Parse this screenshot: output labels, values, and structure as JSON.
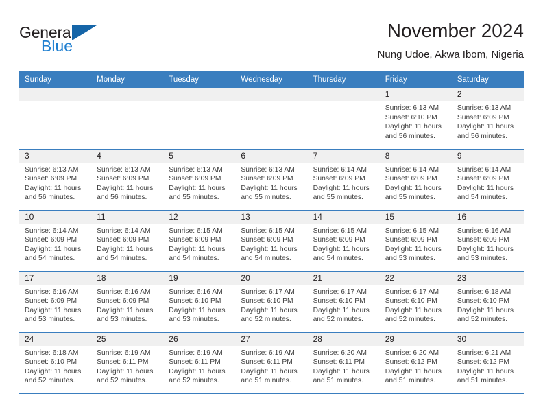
{
  "brand": {
    "line1": "General",
    "line2": "Blue",
    "logo_icon": "triangle-logo-icon",
    "accent_color": "#1f7fd0",
    "triangle_color": "#1565a8"
  },
  "header": {
    "title": "November 2024",
    "subtitle": "Nung Udoe, Akwa Ibom, Nigeria"
  },
  "calendar": {
    "header_bg": "#3a7ebf",
    "daynum_bg": "#f0f0f0",
    "weekday_labels": [
      "Sunday",
      "Monday",
      "Tuesday",
      "Wednesday",
      "Thursday",
      "Friday",
      "Saturday"
    ],
    "weeks": [
      [
        {
          "day": "",
          "sunrise": "",
          "sunset": "",
          "daylight_1": "",
          "daylight_2": ""
        },
        {
          "day": "",
          "sunrise": "",
          "sunset": "",
          "daylight_1": "",
          "daylight_2": ""
        },
        {
          "day": "",
          "sunrise": "",
          "sunset": "",
          "daylight_1": "",
          "daylight_2": ""
        },
        {
          "day": "",
          "sunrise": "",
          "sunset": "",
          "daylight_1": "",
          "daylight_2": ""
        },
        {
          "day": "",
          "sunrise": "",
          "sunset": "",
          "daylight_1": "",
          "daylight_2": ""
        },
        {
          "day": "1",
          "sunrise": "Sunrise: 6:13 AM",
          "sunset": "Sunset: 6:10 PM",
          "daylight_1": "Daylight: 11 hours",
          "daylight_2": "and 56 minutes."
        },
        {
          "day": "2",
          "sunrise": "Sunrise: 6:13 AM",
          "sunset": "Sunset: 6:09 PM",
          "daylight_1": "Daylight: 11 hours",
          "daylight_2": "and 56 minutes."
        }
      ],
      [
        {
          "day": "3",
          "sunrise": "Sunrise: 6:13 AM",
          "sunset": "Sunset: 6:09 PM",
          "daylight_1": "Daylight: 11 hours",
          "daylight_2": "and 56 minutes."
        },
        {
          "day": "4",
          "sunrise": "Sunrise: 6:13 AM",
          "sunset": "Sunset: 6:09 PM",
          "daylight_1": "Daylight: 11 hours",
          "daylight_2": "and 56 minutes."
        },
        {
          "day": "5",
          "sunrise": "Sunrise: 6:13 AM",
          "sunset": "Sunset: 6:09 PM",
          "daylight_1": "Daylight: 11 hours",
          "daylight_2": "and 55 minutes."
        },
        {
          "day": "6",
          "sunrise": "Sunrise: 6:13 AM",
          "sunset": "Sunset: 6:09 PM",
          "daylight_1": "Daylight: 11 hours",
          "daylight_2": "and 55 minutes."
        },
        {
          "day": "7",
          "sunrise": "Sunrise: 6:14 AM",
          "sunset": "Sunset: 6:09 PM",
          "daylight_1": "Daylight: 11 hours",
          "daylight_2": "and 55 minutes."
        },
        {
          "day": "8",
          "sunrise": "Sunrise: 6:14 AM",
          "sunset": "Sunset: 6:09 PM",
          "daylight_1": "Daylight: 11 hours",
          "daylight_2": "and 55 minutes."
        },
        {
          "day": "9",
          "sunrise": "Sunrise: 6:14 AM",
          "sunset": "Sunset: 6:09 PM",
          "daylight_1": "Daylight: 11 hours",
          "daylight_2": "and 54 minutes."
        }
      ],
      [
        {
          "day": "10",
          "sunrise": "Sunrise: 6:14 AM",
          "sunset": "Sunset: 6:09 PM",
          "daylight_1": "Daylight: 11 hours",
          "daylight_2": "and 54 minutes."
        },
        {
          "day": "11",
          "sunrise": "Sunrise: 6:14 AM",
          "sunset": "Sunset: 6:09 PM",
          "daylight_1": "Daylight: 11 hours",
          "daylight_2": "and 54 minutes."
        },
        {
          "day": "12",
          "sunrise": "Sunrise: 6:15 AM",
          "sunset": "Sunset: 6:09 PM",
          "daylight_1": "Daylight: 11 hours",
          "daylight_2": "and 54 minutes."
        },
        {
          "day": "13",
          "sunrise": "Sunrise: 6:15 AM",
          "sunset": "Sunset: 6:09 PM",
          "daylight_1": "Daylight: 11 hours",
          "daylight_2": "and 54 minutes."
        },
        {
          "day": "14",
          "sunrise": "Sunrise: 6:15 AM",
          "sunset": "Sunset: 6:09 PM",
          "daylight_1": "Daylight: 11 hours",
          "daylight_2": "and 54 minutes."
        },
        {
          "day": "15",
          "sunrise": "Sunrise: 6:15 AM",
          "sunset": "Sunset: 6:09 PM",
          "daylight_1": "Daylight: 11 hours",
          "daylight_2": "and 53 minutes."
        },
        {
          "day": "16",
          "sunrise": "Sunrise: 6:16 AM",
          "sunset": "Sunset: 6:09 PM",
          "daylight_1": "Daylight: 11 hours",
          "daylight_2": "and 53 minutes."
        }
      ],
      [
        {
          "day": "17",
          "sunrise": "Sunrise: 6:16 AM",
          "sunset": "Sunset: 6:09 PM",
          "daylight_1": "Daylight: 11 hours",
          "daylight_2": "and 53 minutes."
        },
        {
          "day": "18",
          "sunrise": "Sunrise: 6:16 AM",
          "sunset": "Sunset: 6:09 PM",
          "daylight_1": "Daylight: 11 hours",
          "daylight_2": "and 53 minutes."
        },
        {
          "day": "19",
          "sunrise": "Sunrise: 6:16 AM",
          "sunset": "Sunset: 6:10 PM",
          "daylight_1": "Daylight: 11 hours",
          "daylight_2": "and 53 minutes."
        },
        {
          "day": "20",
          "sunrise": "Sunrise: 6:17 AM",
          "sunset": "Sunset: 6:10 PM",
          "daylight_1": "Daylight: 11 hours",
          "daylight_2": "and 52 minutes."
        },
        {
          "day": "21",
          "sunrise": "Sunrise: 6:17 AM",
          "sunset": "Sunset: 6:10 PM",
          "daylight_1": "Daylight: 11 hours",
          "daylight_2": "and 52 minutes."
        },
        {
          "day": "22",
          "sunrise": "Sunrise: 6:17 AM",
          "sunset": "Sunset: 6:10 PM",
          "daylight_1": "Daylight: 11 hours",
          "daylight_2": "and 52 minutes."
        },
        {
          "day": "23",
          "sunrise": "Sunrise: 6:18 AM",
          "sunset": "Sunset: 6:10 PM",
          "daylight_1": "Daylight: 11 hours",
          "daylight_2": "and 52 minutes."
        }
      ],
      [
        {
          "day": "24",
          "sunrise": "Sunrise: 6:18 AM",
          "sunset": "Sunset: 6:10 PM",
          "daylight_1": "Daylight: 11 hours",
          "daylight_2": "and 52 minutes."
        },
        {
          "day": "25",
          "sunrise": "Sunrise: 6:19 AM",
          "sunset": "Sunset: 6:11 PM",
          "daylight_1": "Daylight: 11 hours",
          "daylight_2": "and 52 minutes."
        },
        {
          "day": "26",
          "sunrise": "Sunrise: 6:19 AM",
          "sunset": "Sunset: 6:11 PM",
          "daylight_1": "Daylight: 11 hours",
          "daylight_2": "and 52 minutes."
        },
        {
          "day": "27",
          "sunrise": "Sunrise: 6:19 AM",
          "sunset": "Sunset: 6:11 PM",
          "daylight_1": "Daylight: 11 hours",
          "daylight_2": "and 51 minutes."
        },
        {
          "day": "28",
          "sunrise": "Sunrise: 6:20 AM",
          "sunset": "Sunset: 6:11 PM",
          "daylight_1": "Daylight: 11 hours",
          "daylight_2": "and 51 minutes."
        },
        {
          "day": "29",
          "sunrise": "Sunrise: 6:20 AM",
          "sunset": "Sunset: 6:12 PM",
          "daylight_1": "Daylight: 11 hours",
          "daylight_2": "and 51 minutes."
        },
        {
          "day": "30",
          "sunrise": "Sunrise: 6:21 AM",
          "sunset": "Sunset: 6:12 PM",
          "daylight_1": "Daylight: 11 hours",
          "daylight_2": "and 51 minutes."
        }
      ]
    ]
  }
}
